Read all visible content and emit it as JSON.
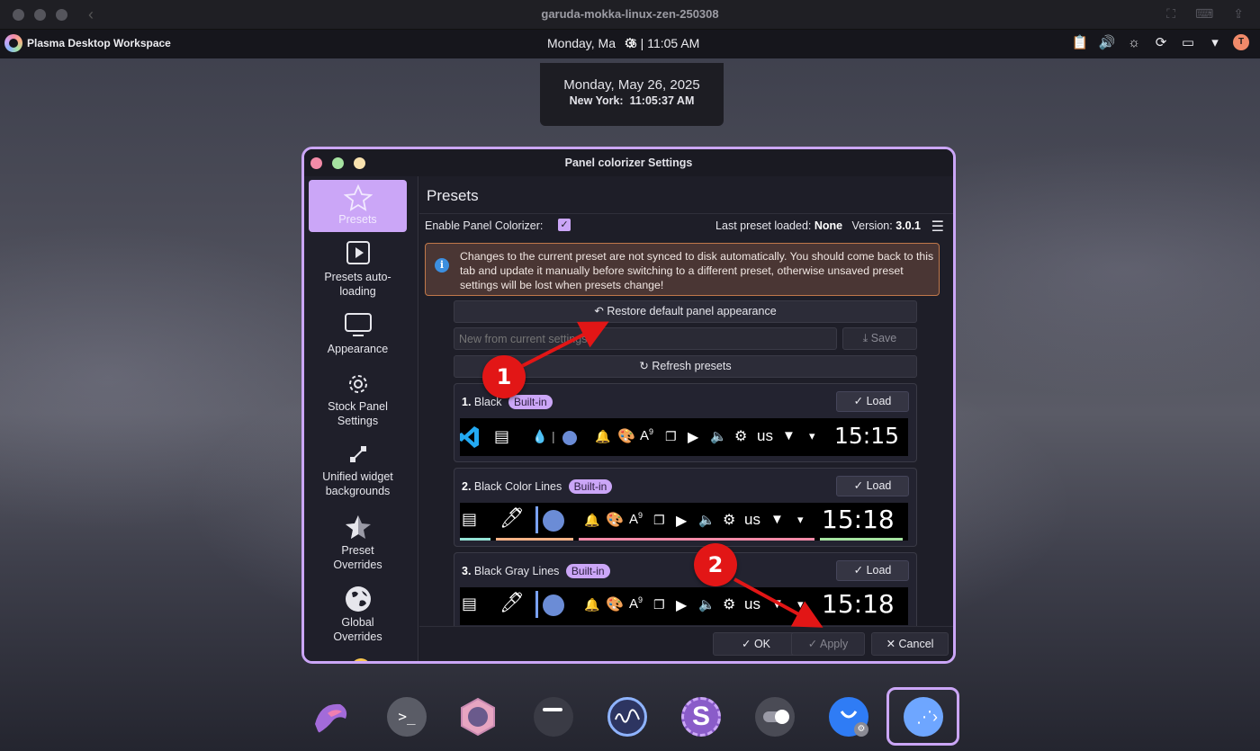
{
  "vm": {
    "title": "garuda-mokka-linux-zen-250308"
  },
  "plasma_panel": {
    "app_name": "Plasma Desktop Workspace",
    "clock_left": "Monday, Ma",
    "clock_right": "6 | 11:05 AM",
    "user_initial": "T"
  },
  "date_popup": {
    "date": "Monday, May 26, 2025",
    "city": "New York:",
    "time": "11:05:37 AM"
  },
  "dialog": {
    "title": "Panel colorizer Settings",
    "sidebar": [
      {
        "label": "Presets",
        "icon": "star-icon",
        "active": true
      },
      {
        "label": "Presets auto-loading",
        "icon": "play-box-icon",
        "active": false
      },
      {
        "label": "Appearance",
        "icon": "monitor-icon",
        "active": false
      },
      {
        "label": "Stock Panel Settings",
        "icon": "gear-icon",
        "active": false
      },
      {
        "label": "Unified widget backgrounds",
        "icon": "connection-icon",
        "active": false
      },
      {
        "label": "Preset Overrides",
        "icon": "half-star-icon",
        "active": false
      },
      {
        "label": "Global Overrides",
        "icon": "globe-icon",
        "active": false
      }
    ],
    "page_title": "Presets",
    "enable_label": "Enable Panel Colorizer:",
    "enable_checked": true,
    "last_preset_label": "Last preset loaded:",
    "last_preset_value": "None",
    "version_label": "Version:",
    "version_value": "3.0.1",
    "info_message": "Changes to the current preset are not synced to disk automatically. You should come back to this tab and update it manually before switching to a different preset, otherwise unsaved preset settings will be lost when presets change!",
    "restore_button": "Restore default panel appearance",
    "new_preset_placeholder": "New from current settings",
    "save_button": "Save",
    "refresh_button": "Refresh presets",
    "load_label": "Load",
    "presets": [
      {
        "number": "1.",
        "name": "Black",
        "badge": "Built-in",
        "preview_clock": "15:15",
        "preview_lang": "us",
        "preview_badge": "9"
      },
      {
        "number": "2.",
        "name": "Black Color Lines",
        "badge": "Built-in",
        "preview_clock": "15:18",
        "preview_lang": "us",
        "preview_badge": "9"
      },
      {
        "number": "3.",
        "name": "Black Gray Lines",
        "badge": "Built-in",
        "preview_clock": "15:18",
        "preview_lang": "us",
        "preview_badge": "9"
      }
    ],
    "ok_button": "OK",
    "apply_button": "Apply",
    "cancel_button": "Cancel"
  },
  "annotations": {
    "marker_1": "1",
    "marker_2": "2",
    "color": "#e21616"
  },
  "dock": [
    {
      "icon": "garuda-eagle-icon"
    },
    {
      "icon": "terminal-icon"
    },
    {
      "icon": "garuda-settings-icon"
    },
    {
      "icon": "window-icon"
    },
    {
      "icon": "system-monitor-icon"
    },
    {
      "icon": "s-app-icon"
    },
    {
      "icon": "toggle-icon"
    },
    {
      "icon": "package-manager-icon"
    },
    {
      "icon": "panel-colorizer-icon",
      "active": true
    }
  ],
  "colors": {
    "accent": "#cba6f7",
    "info_border": "#c0784a",
    "info_bg": "#4a3634"
  }
}
